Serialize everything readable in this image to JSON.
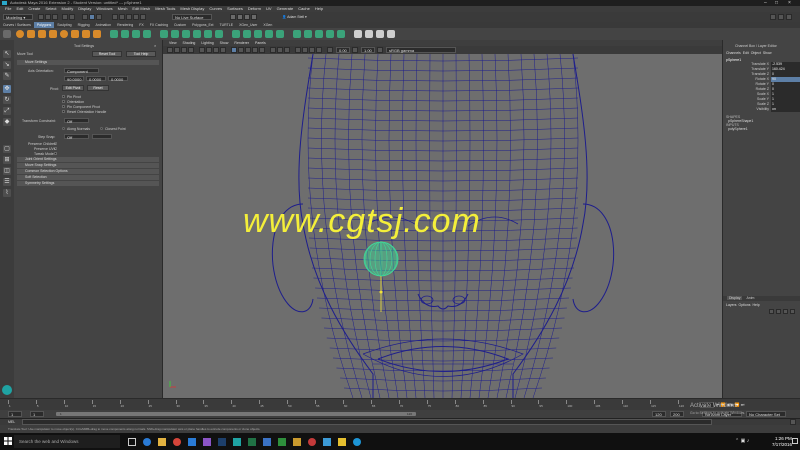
{
  "window": {
    "title": "Autodesk Maya 2016 Extension 2 - Student Version: untitled* --- pSphere1"
  },
  "menubar": [
    "File",
    "Edit",
    "Create",
    "Select",
    "Modify",
    "Display",
    "Windows",
    "Mesh",
    "Edit Mesh",
    "Mesh Tools",
    "Mesh Display",
    "Curves",
    "Surfaces",
    "Deform",
    "UV",
    "Generate",
    "Cache",
    "Help"
  ],
  "statusline": {
    "mode": "Modeling",
    "live_surface": "No Live Surface",
    "user": "Adam Stell"
  },
  "shelf_tabs": {
    "items": [
      "Curves / Surfaces",
      "Polygons",
      "Sculpting",
      "Rigging",
      "Animation",
      "Rendering",
      "FX",
      "FX Caching",
      "Custom",
      "Polygons_Ext",
      "TURTLE",
      "XGen_User",
      "XGen"
    ],
    "active_index": 1
  },
  "tool_settings": {
    "header": "Tool Settings",
    "tool_name": "Move Tool",
    "reset_label": "Reset Tool",
    "help_label": "Tool Help",
    "section_move": "Move Settings",
    "axis_orientation_label": "Axis Orientation:",
    "axis_orientation_value": "Component",
    "vec": [
      "90.0000",
      "0.0000",
      "0.0000"
    ],
    "pivot_label": "Pivot:",
    "edit_pivot": "Edit Pivot",
    "reset": "Reset",
    "pin_pivot": "Pin Pivot",
    "orientation": "Orientation",
    "pin_component_pivot": "Pin Component Pivot",
    "reset_orientation": "Reset Orientation Handle",
    "transform_constraint_label": "Transform Constraint:",
    "transform_constraint_value": "Off",
    "along_normals": "Along Normals",
    "closest_point": "Closest Point",
    "step_snap_label": "Step Snap:",
    "step_snap_value": "Off",
    "preserve_children": "Preserve Children",
    "preserve_uvs": "Preserve UVs",
    "tweak_mode": "Tweak Mode",
    "sections": [
      "Joint Orient Settings",
      "Move Snap Settings",
      "Common Selection Options",
      "Soft Selection",
      "Symmetry Settings"
    ]
  },
  "panel_menu": [
    "View",
    "Shading",
    "Lighting",
    "Show",
    "Renderer",
    "Panels"
  ],
  "panel_toolbar": {
    "val1": "0.00",
    "val2": "1.00",
    "colorspace": "sRGB gamma"
  },
  "viewport": {
    "watermark": "www.cgtsj.com",
    "wire_color": "#1e1e8c",
    "select_color": "#3ddc9a"
  },
  "channel_box": {
    "header": "Channel Box / Layer Editor",
    "menu": [
      "Channels",
      "Edit",
      "Object",
      "Show"
    ],
    "object_name": "pSphere1",
    "channels": [
      {
        "name": "Translate X",
        "value": "-2.539"
      },
      {
        "name": "Translate Y",
        "value": "160.424"
      },
      {
        "name": "Translate Z",
        "value": "0"
      },
      {
        "name": "Rotate X",
        "value": "90"
      },
      {
        "name": "Rotate Y",
        "value": "0"
      },
      {
        "name": "Rotate Z",
        "value": "0"
      },
      {
        "name": "Scale X",
        "value": "1"
      },
      {
        "name": "Scale Y",
        "value": "1"
      },
      {
        "name": "Scale Z",
        "value": "1"
      },
      {
        "name": "Visibility",
        "value": "on"
      }
    ],
    "shapes_label": "SHAPES",
    "shape_name": "pSphereShape1",
    "inputs_label": "INPUTS",
    "input_name": "polySphere1",
    "layer_tabs": [
      "Display",
      "Anim"
    ],
    "layer_menu": [
      "Layers",
      "Options",
      "Help"
    ]
  },
  "time_slider": {
    "ticks": [
      "1",
      "5",
      "10",
      "15",
      "20",
      "25",
      "30",
      "35",
      "40",
      "45",
      "50",
      "55",
      "60",
      "65",
      "70",
      "75",
      "80",
      "85",
      "90",
      "95",
      "100",
      "105",
      "110",
      "115",
      "120"
    ],
    "current_frame": "1"
  },
  "range_slider": {
    "start": "1",
    "inner_start": "1",
    "inner_end": "120",
    "end_a": "120",
    "end_b": "200",
    "anim_layer": "No Anim Layer",
    "char_set": "No Character Set"
  },
  "command_line": {
    "lang": "MEL"
  },
  "help_line": {
    "text": "Translate Tool: Use manipulator to move object(s). Ctrl+MMB+drag to move components along normals. Shift+drag manipulator axis or plane handles to extrude components or clone objects."
  },
  "activate_windows": {
    "title": "Activate Windows",
    "subtitle": "Go to Settings to activate Windows."
  },
  "taskbar": {
    "search_placeholder": "Search the web and Windows",
    "time": "1:26 PM",
    "date": "7/17/2016"
  }
}
